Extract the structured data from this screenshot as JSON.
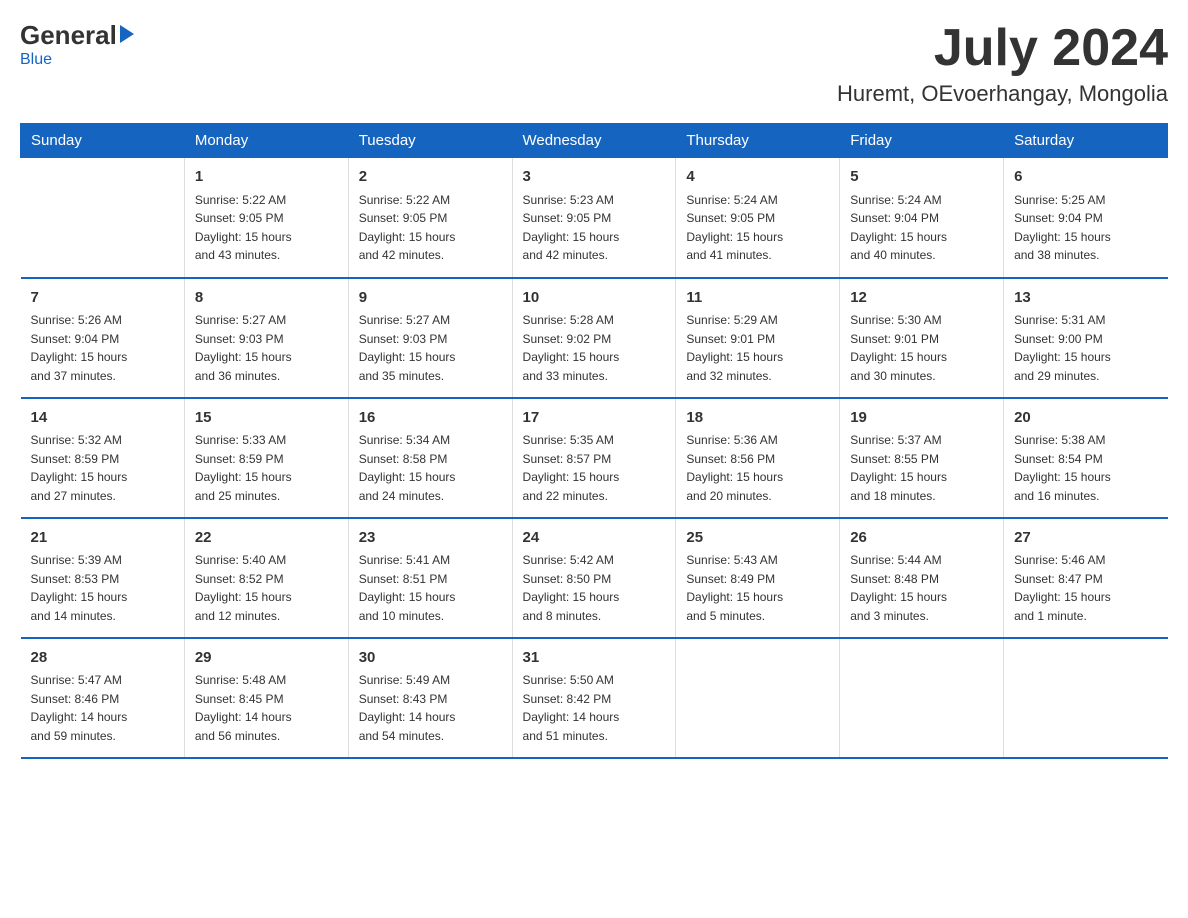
{
  "header": {
    "logo_general": "General",
    "logo_blue": "Blue",
    "month_year": "July 2024",
    "location": "Huremt, OEvoerhangay, Mongolia"
  },
  "weekdays": [
    "Sunday",
    "Monday",
    "Tuesday",
    "Wednesday",
    "Thursday",
    "Friday",
    "Saturday"
  ],
  "weeks": [
    [
      {
        "day": "",
        "info": ""
      },
      {
        "day": "1",
        "info": "Sunrise: 5:22 AM\nSunset: 9:05 PM\nDaylight: 15 hours\nand 43 minutes."
      },
      {
        "day": "2",
        "info": "Sunrise: 5:22 AM\nSunset: 9:05 PM\nDaylight: 15 hours\nand 42 minutes."
      },
      {
        "day": "3",
        "info": "Sunrise: 5:23 AM\nSunset: 9:05 PM\nDaylight: 15 hours\nand 42 minutes."
      },
      {
        "day": "4",
        "info": "Sunrise: 5:24 AM\nSunset: 9:05 PM\nDaylight: 15 hours\nand 41 minutes."
      },
      {
        "day": "5",
        "info": "Sunrise: 5:24 AM\nSunset: 9:04 PM\nDaylight: 15 hours\nand 40 minutes."
      },
      {
        "day": "6",
        "info": "Sunrise: 5:25 AM\nSunset: 9:04 PM\nDaylight: 15 hours\nand 38 minutes."
      }
    ],
    [
      {
        "day": "7",
        "info": "Sunrise: 5:26 AM\nSunset: 9:04 PM\nDaylight: 15 hours\nand 37 minutes."
      },
      {
        "day": "8",
        "info": "Sunrise: 5:27 AM\nSunset: 9:03 PM\nDaylight: 15 hours\nand 36 minutes."
      },
      {
        "day": "9",
        "info": "Sunrise: 5:27 AM\nSunset: 9:03 PM\nDaylight: 15 hours\nand 35 minutes."
      },
      {
        "day": "10",
        "info": "Sunrise: 5:28 AM\nSunset: 9:02 PM\nDaylight: 15 hours\nand 33 minutes."
      },
      {
        "day": "11",
        "info": "Sunrise: 5:29 AM\nSunset: 9:01 PM\nDaylight: 15 hours\nand 32 minutes."
      },
      {
        "day": "12",
        "info": "Sunrise: 5:30 AM\nSunset: 9:01 PM\nDaylight: 15 hours\nand 30 minutes."
      },
      {
        "day": "13",
        "info": "Sunrise: 5:31 AM\nSunset: 9:00 PM\nDaylight: 15 hours\nand 29 minutes."
      }
    ],
    [
      {
        "day": "14",
        "info": "Sunrise: 5:32 AM\nSunset: 8:59 PM\nDaylight: 15 hours\nand 27 minutes."
      },
      {
        "day": "15",
        "info": "Sunrise: 5:33 AM\nSunset: 8:59 PM\nDaylight: 15 hours\nand 25 minutes."
      },
      {
        "day": "16",
        "info": "Sunrise: 5:34 AM\nSunset: 8:58 PM\nDaylight: 15 hours\nand 24 minutes."
      },
      {
        "day": "17",
        "info": "Sunrise: 5:35 AM\nSunset: 8:57 PM\nDaylight: 15 hours\nand 22 minutes."
      },
      {
        "day": "18",
        "info": "Sunrise: 5:36 AM\nSunset: 8:56 PM\nDaylight: 15 hours\nand 20 minutes."
      },
      {
        "day": "19",
        "info": "Sunrise: 5:37 AM\nSunset: 8:55 PM\nDaylight: 15 hours\nand 18 minutes."
      },
      {
        "day": "20",
        "info": "Sunrise: 5:38 AM\nSunset: 8:54 PM\nDaylight: 15 hours\nand 16 minutes."
      }
    ],
    [
      {
        "day": "21",
        "info": "Sunrise: 5:39 AM\nSunset: 8:53 PM\nDaylight: 15 hours\nand 14 minutes."
      },
      {
        "day": "22",
        "info": "Sunrise: 5:40 AM\nSunset: 8:52 PM\nDaylight: 15 hours\nand 12 minutes."
      },
      {
        "day": "23",
        "info": "Sunrise: 5:41 AM\nSunset: 8:51 PM\nDaylight: 15 hours\nand 10 minutes."
      },
      {
        "day": "24",
        "info": "Sunrise: 5:42 AM\nSunset: 8:50 PM\nDaylight: 15 hours\nand 8 minutes."
      },
      {
        "day": "25",
        "info": "Sunrise: 5:43 AM\nSunset: 8:49 PM\nDaylight: 15 hours\nand 5 minutes."
      },
      {
        "day": "26",
        "info": "Sunrise: 5:44 AM\nSunset: 8:48 PM\nDaylight: 15 hours\nand 3 minutes."
      },
      {
        "day": "27",
        "info": "Sunrise: 5:46 AM\nSunset: 8:47 PM\nDaylight: 15 hours\nand 1 minute."
      }
    ],
    [
      {
        "day": "28",
        "info": "Sunrise: 5:47 AM\nSunset: 8:46 PM\nDaylight: 14 hours\nand 59 minutes."
      },
      {
        "day": "29",
        "info": "Sunrise: 5:48 AM\nSunset: 8:45 PM\nDaylight: 14 hours\nand 56 minutes."
      },
      {
        "day": "30",
        "info": "Sunrise: 5:49 AM\nSunset: 8:43 PM\nDaylight: 14 hours\nand 54 minutes."
      },
      {
        "day": "31",
        "info": "Sunrise: 5:50 AM\nSunset: 8:42 PM\nDaylight: 14 hours\nand 51 minutes."
      },
      {
        "day": "",
        "info": ""
      },
      {
        "day": "",
        "info": ""
      },
      {
        "day": "",
        "info": ""
      }
    ]
  ]
}
